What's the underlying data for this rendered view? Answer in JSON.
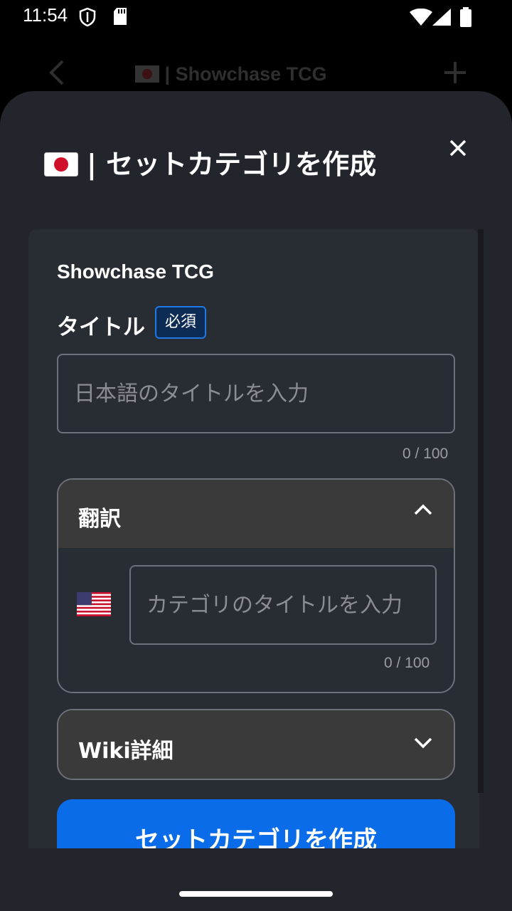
{
  "status_bar": {
    "time": "11:54"
  },
  "background_header": {
    "title": "| Showchase TCG"
  },
  "sheet": {
    "title": "| セットカテゴリを作成",
    "game_name": "Showchase TCG",
    "title_field": {
      "label": "タイトル",
      "required_badge": "必須",
      "placeholder": "日本語のタイトルを入力",
      "value": "",
      "counter": "0 / 100"
    },
    "translation_section": {
      "label": "翻訳",
      "expanded": true,
      "flag_icon": "us-flag-icon",
      "placeholder": "カテゴリのタイトルを入力",
      "value": "",
      "counter": "0 / 100"
    },
    "wiki_section": {
      "label": "Wiki詳細",
      "expanded": false
    },
    "submit_label": "セットカテゴリを作成"
  },
  "colors": {
    "accent": "#0a6ce8",
    "sheet_bg": "#22252b",
    "card_bg": "#282c33",
    "badge_border": "#1e78e6"
  }
}
